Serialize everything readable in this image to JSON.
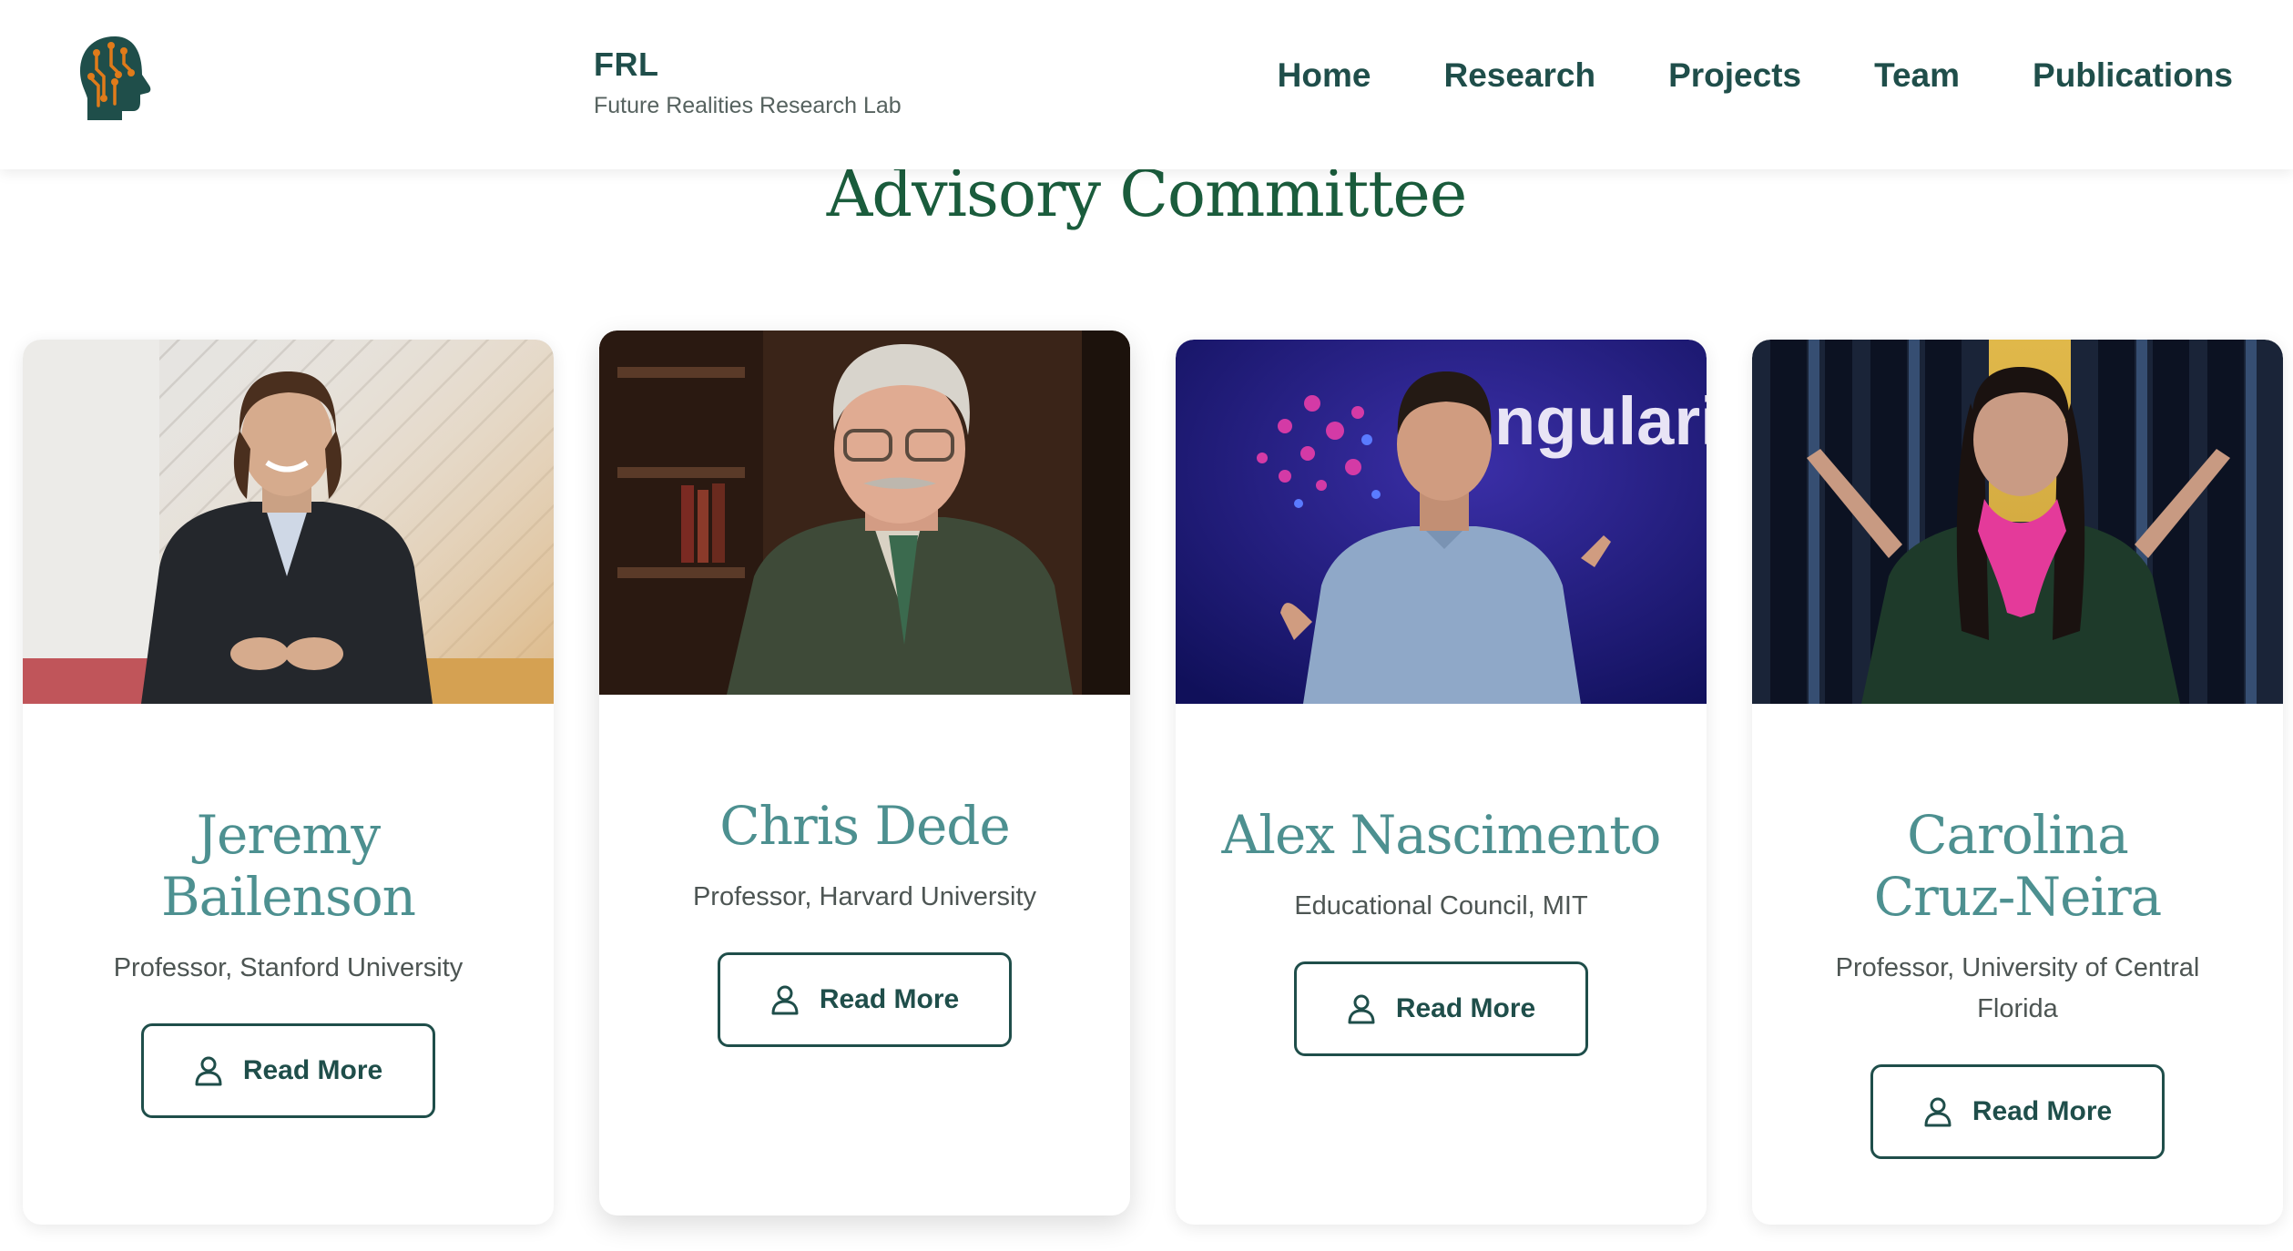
{
  "header": {
    "brand_title": "FRL",
    "brand_subtitle": "Future Realities Research Lab",
    "logo_icon": "head-circuit-icon",
    "nav": [
      "Home",
      "Research",
      "Projects",
      "Team",
      "Publications"
    ]
  },
  "section": {
    "title": "Advisory Committee"
  },
  "members": [
    {
      "name": "Jeremy Bailenson",
      "role": "Professor, Stanford University",
      "button": "Read More"
    },
    {
      "name": "Chris Dede",
      "role": "Professor, Harvard University",
      "button": "Read More"
    },
    {
      "name": "Alex Nascimento",
      "role": "Educational Council, MIT",
      "button": "Read More"
    },
    {
      "name": "Carolina Cruz-Neira",
      "role": "Professor, University of Central Florida",
      "button": "Read More"
    }
  ],
  "photo3_backdrop_text": "ngularit",
  "colors": {
    "primary": "#1f4e4a",
    "name_teal": "#4d9090",
    "heading_green": "#1a5c3c",
    "logo_orange": "#e07b1a"
  }
}
